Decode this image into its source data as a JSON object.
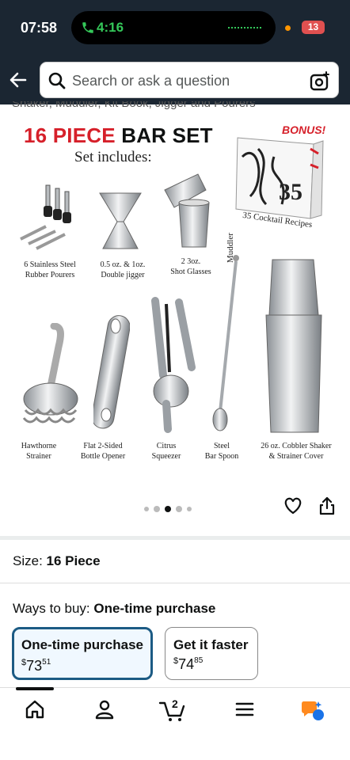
{
  "status_bar": {
    "time": "07:58",
    "call_duration": "4:16",
    "battery": "13"
  },
  "search": {
    "placeholder": "Search or ask a question"
  },
  "breadcrumb": "Shaker, Muddler, Kit Book, Jigger and Pourers",
  "product_image": {
    "title_number": "16 PIECE",
    "title_rest": "BAR SET",
    "subtitle": "Set includes:",
    "bonus": "BONUS!",
    "book_caption": "35 Cocktail Recipes",
    "muddler_caption": "Muddler",
    "items": [
      {
        "label": "6 Stainless Steel\nRubber Pourers"
      },
      {
        "label": "0.5 oz. & 1oz.\nDouble jigger"
      },
      {
        "label": "2  3oz.\nShot Glasses"
      },
      {
        "label": "Hawthorne\nStrainer"
      },
      {
        "label": "Flat 2-Sided\nBottle Opener"
      },
      {
        "label": "Citrus\nSqueezer"
      },
      {
        "label": "Steel\nBar Spoon"
      },
      {
        "label": "26 oz. Cobbler Shaker\n& Strainer Cover"
      }
    ],
    "carousel": {
      "count": 5,
      "active": 2
    }
  },
  "size": {
    "label": "Size:",
    "value": "16 Piece"
  },
  "ways_to_buy": {
    "label": "Ways to buy:",
    "value": "One-time purchase"
  },
  "options": [
    {
      "label": "One-time purchase",
      "currency": "$",
      "dollars": "73",
      "cents": "51",
      "selected": true
    },
    {
      "label": "Get it faster",
      "currency": "$",
      "dollars": "74",
      "cents": "85",
      "selected": false
    }
  ],
  "bottom_nav": [
    {
      "icon": "home-icon"
    },
    {
      "icon": "account-icon"
    },
    {
      "icon": "cart-icon",
      "badge": "2"
    },
    {
      "icon": "menu-icon"
    },
    {
      "icon": "rufus-icon"
    }
  ],
  "colors": {
    "header": "#1b2632",
    "accent_red": "#d6202a",
    "selected_border": "#1c5b84"
  }
}
